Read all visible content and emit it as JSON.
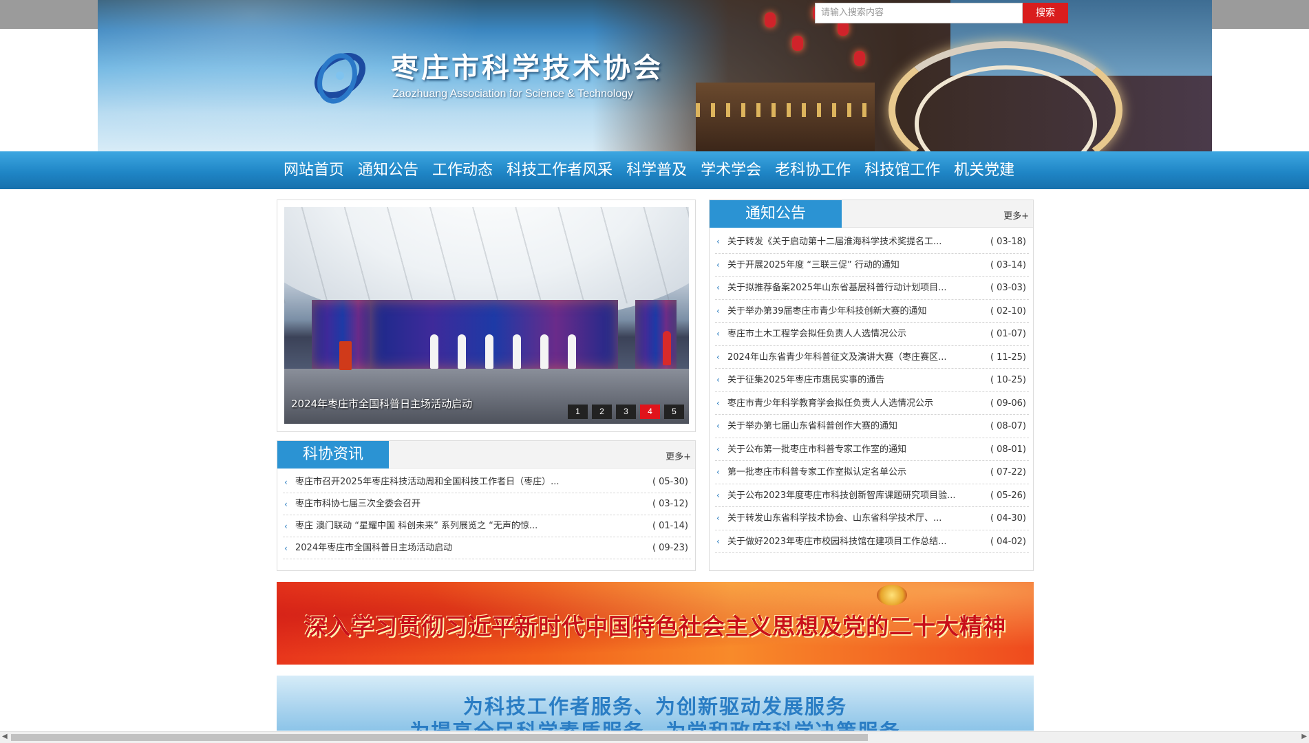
{
  "header": {
    "title": "枣庄市科学技术协会",
    "subtitle": "Zaozhuang Association for Science & Technology",
    "search": {
      "placeholder": "请输入搜索内容",
      "button": "搜索"
    }
  },
  "nav": {
    "items": [
      "网站首页",
      "通知公告",
      "工作动态",
      "科技工作者风采",
      "科学普及",
      "学术学会",
      "老科协工作",
      "科技馆工作",
      "机关党建"
    ]
  },
  "slider": {
    "caption": "2024年枣庄市全国科普日主场活动启动",
    "pages": [
      "1",
      "2",
      "3",
      "4",
      "5"
    ],
    "active_page": "4"
  },
  "kexie_news": {
    "title": "科协资讯",
    "more": "更多+",
    "items": [
      {
        "text": "枣庄市召开2025年枣庄科技活动周和全国科技工作者日（枣庄）...",
        "date": "( 05-30)"
      },
      {
        "text": "枣庄市科协七届三次全委会召开",
        "date": "( 03-12)"
      },
      {
        "text": "枣庄 澳门联动 “星耀中国 科创未来” 系列展览之 “无声的惊...",
        "date": "( 01-14)"
      },
      {
        "text": "2024年枣庄市全国科普日主场活动启动",
        "date": "( 09-23)"
      }
    ]
  },
  "notices": {
    "title": "通知公告",
    "more": "更多+",
    "items": [
      {
        "text": "关于转发《关于启动第十二届淮海科学技术奖提名工...",
        "date": "( 03-18)"
      },
      {
        "text": "关于开展2025年度 “三联三促” 行动的通知",
        "date": "( 03-14)"
      },
      {
        "text": "关于拟推荐备案2025年山东省基层科普行动计划项目...",
        "date": "( 03-03)"
      },
      {
        "text": "关于举办第39届枣庄市青少年科技创新大赛的通知",
        "date": "( 02-10)"
      },
      {
        "text": "枣庄市土木工程学会拟任负责人人选情况公示",
        "date": "( 01-07)"
      },
      {
        "text": "2024年山东省青少年科普征文及演讲大赛（枣庄赛区...",
        "date": "( 11-25)"
      },
      {
        "text": "关于征集2025年枣庄市惠民实事的通告",
        "date": "( 10-25)"
      },
      {
        "text": "枣庄市青少年科学教育学会拟任负责人人选情况公示",
        "date": "( 09-06)"
      },
      {
        "text": "关于举办第七届山东省科普创作大赛的通知",
        "date": "( 08-07)"
      },
      {
        "text": "关于公布第一批枣庄市科普专家工作室的通知",
        "date": "( 08-01)"
      },
      {
        "text": "第一批枣庄市科普专家工作室拟认定名单公示",
        "date": "( 07-22)"
      },
      {
        "text": "关于公布2023年度枣庄市科技创新智库课题研究项目验...",
        "date": "( 05-26)"
      },
      {
        "text": "关于转发山东省科学技术协会、山东省科学技术厅、...",
        "date": "( 04-30)"
      },
      {
        "text": "关于做好2023年枣庄市校园科技馆在建项目工作总结...",
        "date": "( 04-02)"
      }
    ]
  },
  "banners": {
    "red": "深入学习贯彻习近平新时代中国特色社会主义思想及党的二十大精神",
    "blue_line1": "为科技工作者服务、为创新驱动发展服务",
    "blue_line2": "为提高全民科学素质服务、为党和政府科学决策服务"
  },
  "colors": {
    "nav": "#1f86c6",
    "accent_red": "#e0131b",
    "tab_blue": "#2b93d3"
  }
}
